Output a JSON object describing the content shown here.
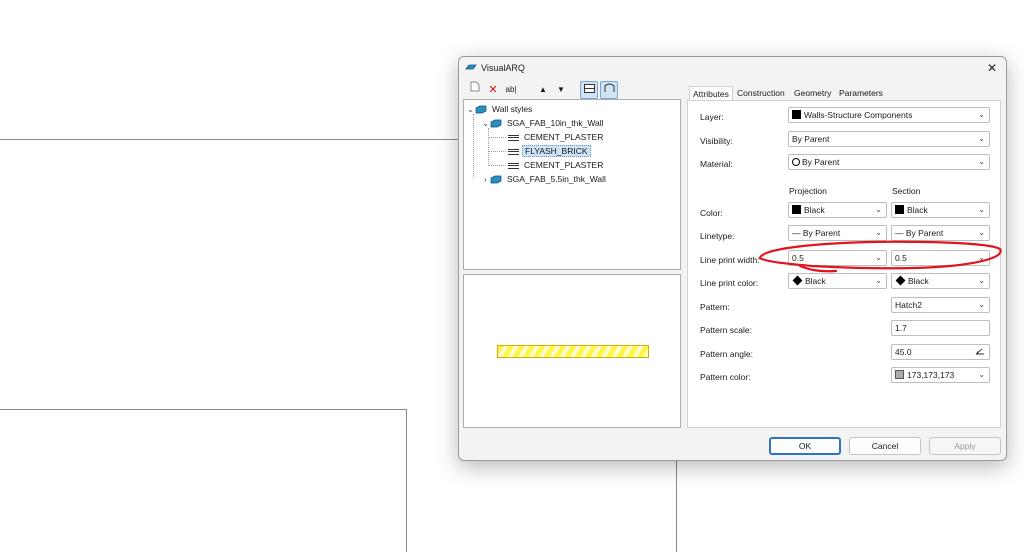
{
  "dialog": {
    "title": "VisualARQ",
    "close_icon": "close-icon"
  },
  "toolbar": {
    "icons": [
      "new-document-icon",
      "delete-icon",
      "rename-icon",
      "move-up-icon",
      "move-down-icon",
      "plan-view-icon",
      "section-view-icon"
    ]
  },
  "tree": {
    "root": "Wall styles",
    "style1": "SGA_FAB_10in_thk_Wall",
    "layers": [
      "CEMENT_PLASTER",
      "FLYASH_BRICK",
      "CEMENT_PLASTER"
    ],
    "style2": "SGA_FAB_5.5in_thk_Wall",
    "selected_index": 1
  },
  "preview": {
    "hatch_color": "#fff44a"
  },
  "tabs": [
    "Attributes",
    "Construction",
    "Geometry",
    "Parameters"
  ],
  "attributes": {
    "layer_label": "Layer:",
    "layer_value": "Walls-Structure Components",
    "visibility_label": "Visibility:",
    "visibility_value": "By Parent",
    "material_label": "Material:",
    "material_value": "By Parent",
    "col_projection": "Projection",
    "col_section": "Section",
    "color_label": "Color:",
    "color_projection": "Black",
    "color_section": "Black",
    "linetype_label": "Linetype:",
    "linetype_projection": "— By Parent",
    "linetype_section": "— By Parent",
    "lpw_label": "Line print width:",
    "lpw_projection": "0.5",
    "lpw_section": "0.5",
    "lpc_label": "Line print color:",
    "lpc_projection": "Black",
    "lpc_section": "Black",
    "pattern_label": "Pattern:",
    "pattern_value": "Hatch2",
    "pscale_label": "Pattern scale:",
    "pscale_value": "1.7",
    "pangle_label": "Pattern angle:",
    "pangle_value": "45.0",
    "pcolor_label": "Pattern color:",
    "pcolor_value": "173,173,173"
  },
  "buttons": {
    "ok": "OK",
    "cancel": "Cancel",
    "apply": "Apply"
  },
  "colors": {
    "accent": "#2f73c4",
    "annotation": "#e0141e"
  }
}
